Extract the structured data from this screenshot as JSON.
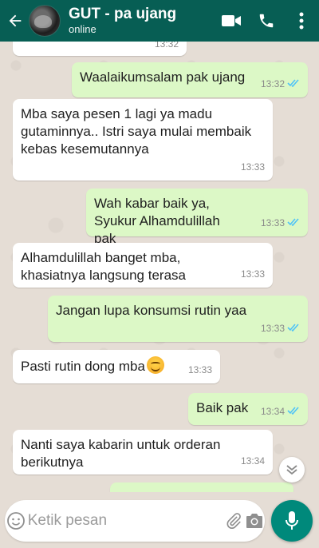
{
  "header": {
    "contact_name": "GUT - pa ujang",
    "status": "online"
  },
  "messages": [
    {
      "dir": "in",
      "text": "",
      "time": "13:32",
      "partial": true
    },
    {
      "dir": "out",
      "text": "Waalaikumsalam pak ujang",
      "time": "13:32",
      "read": true
    },
    {
      "dir": "in",
      "text": "Mba saya pesen 1 lagi ya madu gutaminnya.. Istri saya mulai membaik kebas kesemutannya",
      "time": "13:33"
    },
    {
      "dir": "out",
      "text": "Wah kabar baik ya, Syukur Alhamdulillah pak",
      "time": "13:33",
      "read": true
    },
    {
      "dir": "in",
      "text": "Alhamdulillah banget mba, khasiatnya langsung terasa",
      "time": "13:33"
    },
    {
      "dir": "out",
      "text": "Jangan lupa konsumsi rutin yaa",
      "time": "13:33",
      "read": true
    },
    {
      "dir": "in",
      "text": "Pasti rutin dong mba",
      "time": "13:33",
      "emoji": "smiling-face"
    },
    {
      "dir": "out",
      "text": "Baik pak",
      "time": "13:34",
      "read": true
    },
    {
      "dir": "in",
      "text": "Nanti saya kabarin untuk orderan berikutnya",
      "time": "13:34"
    }
  ],
  "input": {
    "placeholder": "Ketik pesan"
  },
  "colors": {
    "header": "#075e54",
    "outgoing_bubble": "#dcf8c6",
    "incoming_bubble": "#ffffff",
    "read_ticks": "#4fc3f7",
    "mic_button": "#00897b",
    "chat_background": "#e5ddd5"
  }
}
